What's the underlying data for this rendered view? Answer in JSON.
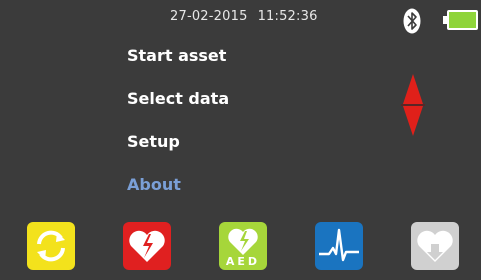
{
  "status": {
    "date": "27-02-2015",
    "time": "11:52:36",
    "bluetooth_icon": "bluetooth-icon",
    "battery_icon": "battery-full-icon",
    "battery_color": "#8fd43a"
  },
  "menu": {
    "items": [
      {
        "label": "Start asset",
        "selected": false
      },
      {
        "label": "Select data",
        "selected": false
      },
      {
        "label": "Setup",
        "selected": false
      },
      {
        "label": "About",
        "selected": true
      }
    ],
    "selected_color": "#7a9fd6",
    "scroll_arrows_color": "#e0201a"
  },
  "toolbar": {
    "buttons": [
      {
        "icon": "refresh-icon",
        "color": "#f3e21c"
      },
      {
        "icon": "broken-heart-icon",
        "color": "#e02020"
      },
      {
        "icon": "aed-heart-icon",
        "color": "#a6d63a",
        "text": "AED"
      },
      {
        "icon": "ecg-waveform-icon",
        "color": "#1a74c0"
      },
      {
        "icon": "heart-download-icon",
        "color": "#d0d0d0"
      }
    ]
  }
}
